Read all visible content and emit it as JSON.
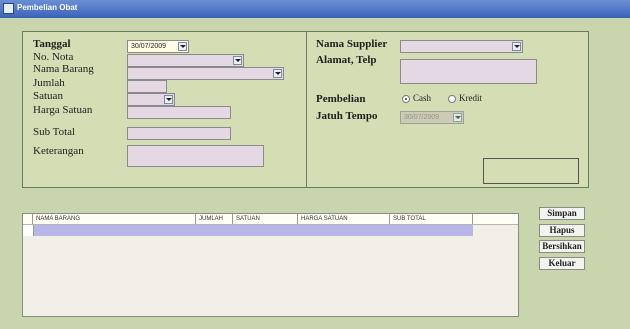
{
  "window": {
    "title": "Pembelian Obat"
  },
  "form_left": {
    "tanggal": {
      "label": "Tanggal",
      "value": "30/07/2009"
    },
    "no_nota": {
      "label": "No. Nota",
      "value": ""
    },
    "nama_barang": {
      "label": "Nama Barang",
      "value": ""
    },
    "jumlah": {
      "label": "Jumlah",
      "value": ""
    },
    "satuan": {
      "label": "Satuan",
      "value": ""
    },
    "harga_satuan": {
      "label": "Harga Satuan",
      "value": ""
    },
    "sub_total": {
      "label": "Sub Total",
      "value": ""
    },
    "keterangan": {
      "label": "Keterangan",
      "value": ""
    }
  },
  "form_right": {
    "nama_supplier": {
      "label": "Nama Supplier",
      "value": ""
    },
    "alamat_telp": {
      "label": "Alamat, Telp",
      "value": ""
    },
    "pembelian": {
      "label": "Pembelian",
      "options": [
        "Cash",
        "Kredit"
      ],
      "selected": "Cash"
    },
    "jatuh_tempo": {
      "label": "Jatuh Tempo",
      "value": "30/07/2009"
    }
  },
  "grid": {
    "columns": [
      "NAMA BARANG",
      "JUMLAH",
      "SATUAN",
      "HARGA SATUAN",
      "SUB TOTAL"
    ]
  },
  "buttons": {
    "simpan": "Simpan",
    "hapus": "Hapus",
    "bersihkan": "Bersihkan",
    "keluar": "Keluar"
  }
}
